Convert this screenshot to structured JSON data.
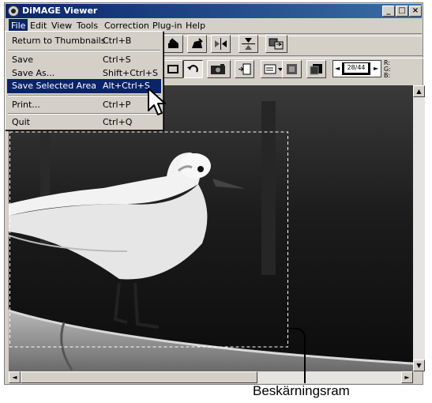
{
  "window": {
    "title": "DiMAGE Viewer"
  },
  "titlebar_buttons": {
    "minimize": "_",
    "maximize": "□",
    "close": "×"
  },
  "menubar": [
    "File",
    "Edit",
    "View",
    "Tools",
    "Correction",
    "Plug-in",
    "Help"
  ],
  "file_menu": {
    "items": [
      {
        "label": "Return to Thumbnails",
        "shortcut": "Ctrl+B"
      },
      {
        "label": "Save",
        "shortcut": "Ctrl+S"
      },
      {
        "label": "Save As...",
        "shortcut": "Shift+Ctrl+S"
      },
      {
        "label": "Save Selected Area",
        "shortcut": "Alt+Ctrl+S"
      },
      {
        "label": "Print...",
        "shortcut": "Ctrl+P"
      },
      {
        "label": "Quit",
        "shortcut": "Ctrl+Q"
      }
    ]
  },
  "frame_counter": "28/44",
  "rgb_readout": {
    "r": "R:",
    "g": "G:",
    "b": "B:"
  },
  "scroll_arrows": {
    "up": "▲",
    "down": "▼",
    "left": "◄",
    "right": "►"
  },
  "caption": "Beskärningsram",
  "colors": {
    "title_active": "#0a246a",
    "highlight": "#0a246a",
    "face": "#d4d0c8"
  }
}
